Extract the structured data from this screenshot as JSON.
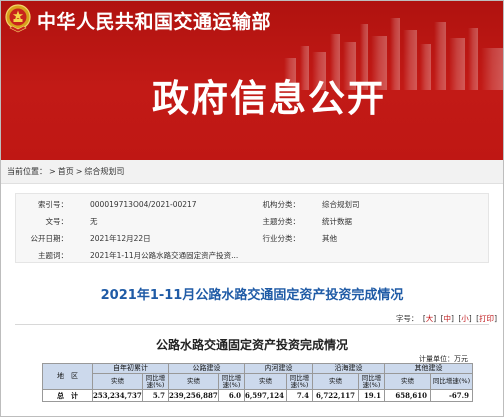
{
  "site": {
    "title": "中华人民共和国交通运输部"
  },
  "banner": {
    "title": "政府信息公开"
  },
  "breadcrumb": {
    "prefix": "当前位置：",
    "items": [
      "首页",
      "综合规划司"
    ],
    "separator": ">"
  },
  "meta": {
    "index_label": "索引号：",
    "index_value": "000019713O04/2021-00217",
    "category_label": "机构分类：",
    "category_value": "综合规划司",
    "doc_no_label": "文号：",
    "doc_no_value": "无",
    "topic_label": "主题分类：",
    "topic_value": "统计数据",
    "date_label": "公开日期：",
    "date_value": "2021年12月22日",
    "industry_label": "行业分类：",
    "industry_value": "其他",
    "subject_label": "主题词：",
    "subject_value": "2021年1-11月公路水路交通固定资产投资..."
  },
  "article": {
    "title": "2021年1-11月公路水路交通固定资产投资完成情况",
    "font_label": "字号：",
    "font_large": "大",
    "font_medium": "中",
    "font_small": "小",
    "print": "打印"
  },
  "table": {
    "title": "公路水路交通固定资产投资完成情况",
    "unit": "计量单位：万元",
    "region_header": "地　区",
    "group_headers": [
      "自年初累计",
      "公路建设",
      "内河建设",
      "沿海建设",
      "其他建设"
    ],
    "sub_actual": "实绩",
    "sub_growth": "同比增速(%)",
    "rows": [
      {
        "region": "总　计",
        "values": [
          "253,234,737",
          "5.7",
          "239,256,887",
          "6.0",
          "6,597,124",
          "7.4",
          "6,722,117",
          "19.1",
          "658,610",
          "-67.9"
        ]
      }
    ]
  },
  "colors": {
    "banner_red": "#c21a16",
    "title_blue": "#1f5ba6",
    "table_header_bg": "#ccd9ec"
  }
}
